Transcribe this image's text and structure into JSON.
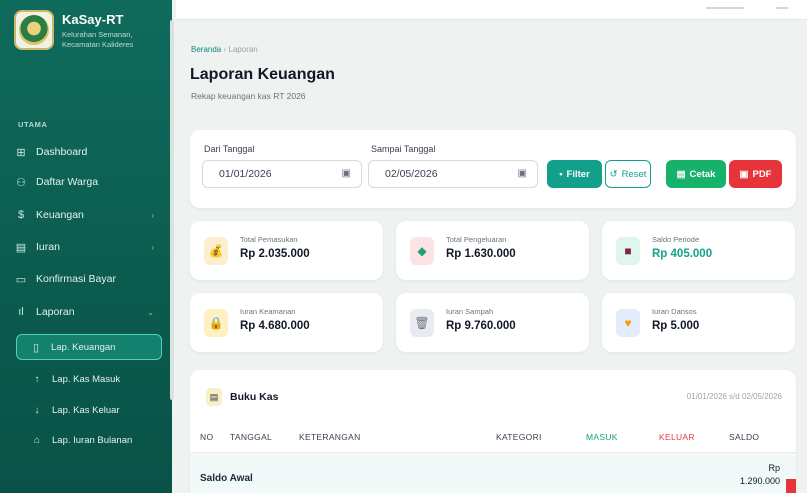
{
  "app": {
    "name": "KaSay-RT",
    "subtitle": "Kelurahan Semanan, Kecamatan Kalideres"
  },
  "sidebar": {
    "section": "UTAMA",
    "items": [
      {
        "label": "Dashboard",
        "icon": "grid-icon"
      },
      {
        "label": "Daftar Warga",
        "icon": "users-icon"
      },
      {
        "label": "Keuangan",
        "icon": "dollar-icon"
      },
      {
        "label": "Iuran",
        "icon": "document-icon"
      },
      {
        "label": "Konfirmasi Bayar",
        "icon": "card-icon"
      },
      {
        "label": "Laporan",
        "icon": "bar-chart-icon"
      }
    ],
    "subitems": [
      {
        "label": "Lap. Keuangan",
        "icon": "file-icon"
      },
      {
        "label": "Lap. Kas Masuk",
        "icon": "arrow-up-icon"
      },
      {
        "label": "Lap. Kas Keluar",
        "icon": "arrow-down-icon"
      },
      {
        "label": "Lap. Iuran Bulanan",
        "icon": "home-icon"
      }
    ]
  },
  "header": {
    "breadcrumb_home": "Beranda",
    "breadcrumb_sep": "›",
    "breadcrumb_current": "Laporan",
    "title": "Laporan Keuangan",
    "subtitle": "Rekap keuangan kas RT 2026"
  },
  "filter": {
    "from_label": "Dari Tanggal",
    "from_value": "01/01/2026",
    "to_label": "Sampai Tanggal",
    "to_value": "02/05/2026",
    "filter_btn": "Filter",
    "reset_btn": "Reset",
    "print_btn": "Cetak",
    "pdf_btn": "PDF"
  },
  "stats": [
    {
      "label": "Total Pemasukan",
      "value": "Rp 2.035.000",
      "value_color": "#111827",
      "icon_bg": "#fcefcf"
    },
    {
      "label": "Total Pengeluaran",
      "value": "Rp 1.630.000",
      "value_color": "#111827",
      "icon_bg": "#fde3e4"
    },
    {
      "label": "Saldo Periode",
      "value": "Rp 405.000",
      "value_color": "#13a389",
      "icon_bg": "#dff5ef"
    },
    {
      "label": "Iuran Keamanan",
      "value": "Rp 4.680.000",
      "value_color": "#111827",
      "icon_bg": "#fff0c2"
    },
    {
      "label": "Iuran Sampah",
      "value": "Rp 9.760.000",
      "value_color": "#111827",
      "icon_bg": "#e8ebf0"
    },
    {
      "label": "Iuran Dansos",
      "value": "Rp 5.000",
      "value_color": "#111827",
      "icon_bg": "#e3ecfb"
    }
  ],
  "ledger": {
    "title": "Buku Kas",
    "range": "01/01/2026 s/d 02/05/2026",
    "columns": {
      "no": "NO",
      "date": "TANGGAL",
      "desc": "KETERANGAN",
      "category": "KATEGORI",
      "in": "MASUK",
      "out": "KELUAR",
      "balance": "SALDO"
    },
    "opening_label": "Saldo Awal",
    "opening_currency": "Rp",
    "opening_value": "1.290.000"
  }
}
